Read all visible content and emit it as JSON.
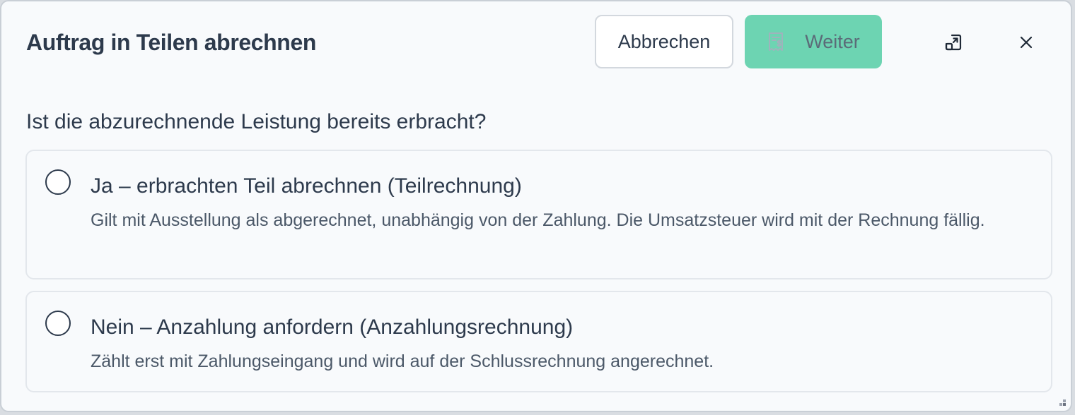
{
  "dialog": {
    "title": "Auftrag in Teilen abrechnen",
    "cancel_label": "Abbrechen",
    "next_label": "Weiter",
    "next_icon": "receipt-icon",
    "expand_icon": "expand-icon",
    "close_icon": "close-icon"
  },
  "question": "Ist die abzurechnende Leistung bereits erbracht?",
  "options": [
    {
      "title": "Ja – erbrachten Teil abrechnen (Teilrechnung)",
      "description": "Gilt mit Ausstellung als abgerechnet, unabhängig von der Zahlung. Die Umsatzsteuer wird mit der Rechnung fällig.",
      "selected": false
    },
    {
      "title": "Nein – Anzahlung anfordern (Anzahlungsrechnung)",
      "description": "Zählt erst mit Zahlungseingang und wird auf der Schlussrechnung angerechnet.",
      "selected": false
    }
  ],
  "colors": {
    "primary_button": "#6dd4b2",
    "text": "#2d3a4c",
    "background": "#f8fafc"
  }
}
